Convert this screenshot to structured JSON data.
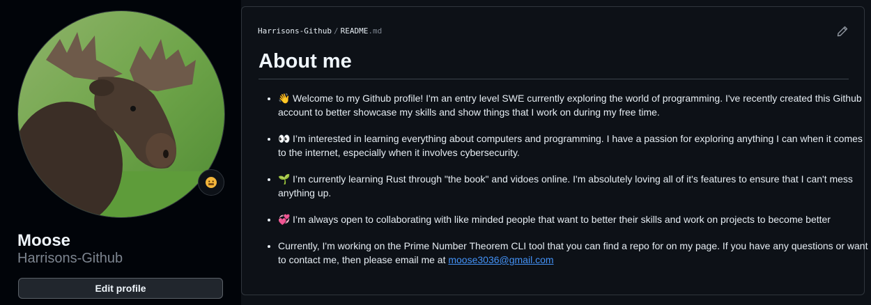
{
  "profile": {
    "name": "Moose",
    "login": "Harrisons-Github",
    "edit_button": "Edit profile",
    "avatar_icon": "moose-avatar",
    "status_icon": "status-emoji-icon"
  },
  "readme": {
    "owner": "Harrisons-Github",
    "separator": "/",
    "file_base": "README",
    "file_ext": ".md",
    "edit_icon": "pencil-icon",
    "heading": "About me",
    "items": [
      {
        "emoji": "👋",
        "text": "Welcome to my Github profile! I'm an entry level SWE currently exploring the world of programming. I've recently created this Github account to better showcase my skills and show things that I work on during my free time."
      },
      {
        "emoji": "👀",
        "text": "I’m interested in learning everything about computers and programming. I have a passion for exploring anything I can when it comes to the internet, especially when it involves cybersecurity."
      },
      {
        "emoji": "🌱",
        "text": "I’m currently learning Rust through \"the book\" and vidoes online. I'm absolutely loving all of it's features to ensure that I can't mess anything up."
      },
      {
        "emoji": "💞️",
        "text": "I’m always open to collaborating with like minded people that want to better their skills and work on projects to become better"
      }
    ],
    "last_item_text": "Currently, I'm working on the Prime Number Theorem CLI tool that you can find a repo for on my page. If you have any questions or want to contact me, then please email me at ",
    "email": "moose3036@gmail.com"
  }
}
